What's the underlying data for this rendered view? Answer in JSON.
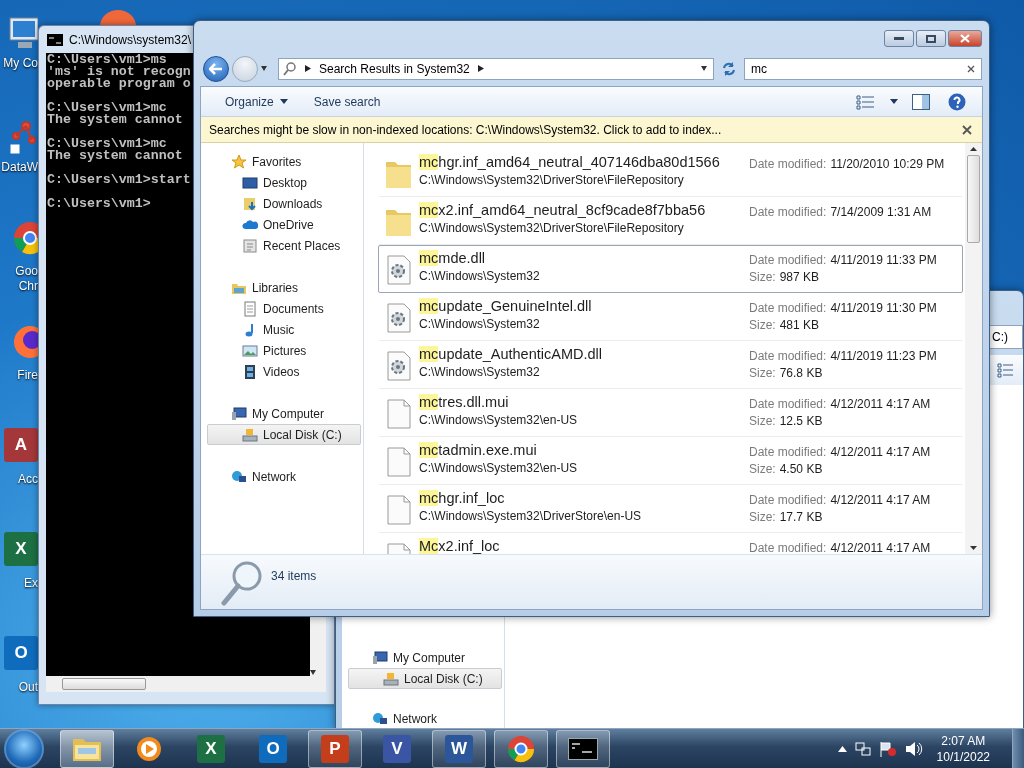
{
  "desktop_icons": [
    {
      "kind": "computer",
      "lines": [
        "My Co"
      ]
    },
    {
      "kind": "network-map",
      "lines": [
        "DataW"
      ]
    },
    {
      "kind": "chrome",
      "lines": [
        "Goo",
        "Chr"
      ]
    },
    {
      "kind": "firefox",
      "lines": [
        "Fire"
      ]
    },
    {
      "kind": "access",
      "glyph": "A",
      "lines": [
        "Acc"
      ]
    },
    {
      "kind": "excel",
      "glyph": "X",
      "lines": [
        "Ex"
      ]
    },
    {
      "kind": "outlook",
      "glyph": "O",
      "lines": [
        "Out"
      ]
    }
  ],
  "console": {
    "title": "C:\\Windows\\system32\\",
    "blocks": [
      [
        "C:\\Users\\vm1>ms",
        "'ms' is not recogn",
        "operable program o"
      ],
      [
        "C:\\Users\\vm1>mc",
        "The system cannot"
      ],
      [
        "C:\\Users\\vm1>mc",
        "The system cannot"
      ],
      [
        "C:\\Users\\vm1>start"
      ],
      [
        "C:\\Users\\vm1>"
      ]
    ]
  },
  "background_explorer": {
    "address_tail": "C:)",
    "nav": [
      {
        "label": "My Computer",
        "kind": "computer",
        "selected": false,
        "children": [
          {
            "label": "Local Disk (C:)",
            "kind": "disk",
            "selected": true
          }
        ]
      },
      {
        "label": "Network",
        "kind": "network",
        "selected": false
      }
    ]
  },
  "explorer": {
    "address": "Search Results in System32",
    "search": "mc",
    "toolbar": [
      "Organize",
      "Save search"
    ],
    "infobar": "Searches might be slow in non-indexed locations: C:\\Windows\\System32. Click to add to index...",
    "nav": [
      {
        "label": "Favorites",
        "kind": "star",
        "selected": false,
        "children": [
          {
            "label": "Desktop",
            "kind": "desktop",
            "selected": false
          },
          {
            "label": "Downloads",
            "kind": "downloads",
            "selected": false
          },
          {
            "label": "OneDrive",
            "kind": "cloud",
            "selected": false
          },
          {
            "label": "Recent Places",
            "kind": "recent",
            "selected": false
          }
        ]
      },
      {
        "label": "Libraries",
        "kind": "library",
        "selected": false,
        "children": [
          {
            "label": "Documents",
            "kind": "document",
            "selected": false
          },
          {
            "label": "Music",
            "kind": "music",
            "selected": false
          },
          {
            "label": "Pictures",
            "kind": "picture",
            "selected": false
          },
          {
            "label": "Videos",
            "kind": "video",
            "selected": false
          }
        ]
      },
      {
        "label": "My Computer",
        "kind": "computer",
        "selected": false,
        "children": [
          {
            "label": "Local Disk (C:)",
            "kind": "disk",
            "selected": true
          }
        ]
      },
      {
        "label": "Network",
        "kind": "network",
        "selected": false
      }
    ],
    "results": [
      {
        "kind": "folder",
        "match": "mc",
        "rest": "hgr.inf_amd64_neutral_407146dba80d1566",
        "path": "C:\\Windows\\System32\\DriverStore\\FileRepository",
        "date_label": "Date modified:",
        "date": "11/20/2010 10:29 PM",
        "selected": false
      },
      {
        "kind": "folder",
        "match": "mc",
        "rest": "x2.inf_amd64_neutral_8cf9cade8f7bba56",
        "path": "C:\\Windows\\System32\\DriverStore\\FileRepository",
        "date_label": "Date modified:",
        "date": "7/14/2009 1:31 AM",
        "selected": false
      },
      {
        "kind": "dll",
        "match": "mc",
        "rest": "mde.dll",
        "path": "C:\\Windows\\System32",
        "date_label": "Date modified:",
        "date": "4/11/2019 11:33 PM",
        "size_label": "Size:",
        "size": "987 KB",
        "selected": true
      },
      {
        "kind": "dll",
        "match": "mc",
        "rest": "update_GenuineIntel.dll",
        "path": "C:\\Windows\\System32",
        "date_label": "Date modified:",
        "date": "4/11/2019 11:30 PM",
        "size_label": "Size:",
        "size": "481 KB",
        "selected": false
      },
      {
        "kind": "dll",
        "match": "mc",
        "rest": "update_AuthenticAMD.dll",
        "path": "C:\\Windows\\System32",
        "date_label": "Date modified:",
        "date": "4/11/2019 11:23 PM",
        "size_label": "Size:",
        "size": "76.8 KB",
        "selected": false
      },
      {
        "kind": "file",
        "match": "mc",
        "rest": "tres.dll.mui",
        "path": "C:\\Windows\\System32\\en-US",
        "date_label": "Date modified:",
        "date": "4/12/2011 4:17 AM",
        "size_label": "Size:",
        "size": "12.5 KB",
        "selected": false
      },
      {
        "kind": "file",
        "match": "mc",
        "rest": "tadmin.exe.mui",
        "path": "C:\\Windows\\System32\\en-US",
        "date_label": "Date modified:",
        "date": "4/12/2011 4:17 AM",
        "size_label": "Size:",
        "size": "4.50 KB",
        "selected": false
      },
      {
        "kind": "file",
        "match": "mc",
        "rest": "hgr.inf_loc",
        "path": "C:\\Windows\\System32\\DriverStore\\en-US",
        "date_label": "Date modified:",
        "date": "4/12/2011 4:17 AM",
        "size_label": "Size:",
        "size": "17.7 KB",
        "selected": false
      },
      {
        "kind": "file",
        "match": "Mc",
        "rest": "x2.inf_loc",
        "date_label": "Date modified:",
        "date": "4/12/2011 4:17 AM",
        "selected": false
      }
    ],
    "details": {
      "count": "34 items"
    }
  },
  "taskbar": {
    "apps": [
      {
        "kind": "explorer",
        "running": true,
        "selected": true
      },
      {
        "kind": "media",
        "running": false,
        "selected": false
      },
      {
        "kind": "excel",
        "glyph": "X",
        "running": false,
        "selected": false
      },
      {
        "kind": "outlook",
        "glyph": "O",
        "running": false,
        "selected": false
      },
      {
        "kind": "powerpoint",
        "glyph": "P",
        "running": true,
        "selected": false
      },
      {
        "kind": "visio",
        "glyph": "V",
        "running": false,
        "selected": false
      },
      {
        "kind": "word",
        "glyph": "W",
        "running": true,
        "selected": false
      },
      {
        "kind": "chrome",
        "running": true,
        "selected": false
      },
      {
        "kind": "console",
        "running": true,
        "selected": false
      }
    ],
    "time": "2:07 AM",
    "date": "10/1/2022"
  }
}
